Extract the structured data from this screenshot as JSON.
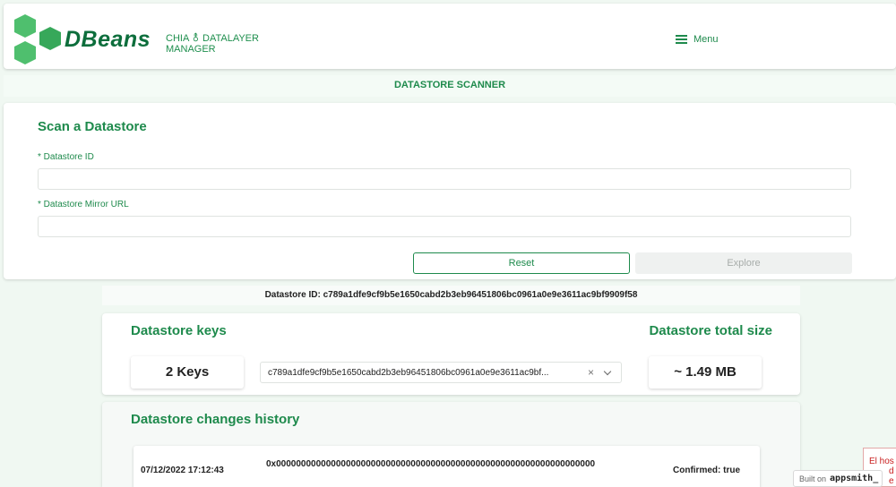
{
  "header": {
    "logo_word": "DBeans",
    "subtitle_line1": "CHIA ⚨ DATALAYER",
    "subtitle_line2": "MANAGER",
    "menu_label": "Menu",
    "menu_icon": "hamburger-icon",
    "logo_icon": "hexagon-cluster-logo"
  },
  "page_title": "DATASTORE SCANNER",
  "scan_form": {
    "title": "Scan a Datastore",
    "datastore_id_label": "* Datastore ID",
    "datastore_id_value": "",
    "mirror_url_label": "* Datastore Mirror URL",
    "mirror_url_value": "",
    "reset_label": "Reset",
    "explore_label": "Explore"
  },
  "datastore_id_line": "Datastore ID: c789a1dfe9cf9b5e1650cabd2b3eb96451806bc0961a0e9e3611ac9bf9909f58",
  "keys_section": {
    "title": "Datastore keys",
    "count_text": "2 Keys",
    "selected_key": "c789a1dfe9cf9b5e1650cabd2b3eb96451806bc0961a0e9e3611ac9bf...",
    "clear_glyph": "×",
    "size_title": "Datastore total size",
    "size_text": "~ 1.49 MB"
  },
  "history": {
    "title": "Datastore changes history",
    "rows": [
      {
        "date": "07/12/2022 17:12:43",
        "hash": "0x0000000000000000000000000000000000000000000000000000000000000000",
        "status": "Confirmed: true"
      }
    ]
  },
  "overlay": {
    "host_text_line1": "El hos",
    "host_text_line2": "d",
    "host_text_line3": "e",
    "built_on": "Built on",
    "built_brand": "appsmith_"
  },
  "colors": {
    "accent": "#1e8a4c",
    "logo_dark": "#0d6e3c",
    "logo_light": "#4fbf6e",
    "page_bg": "#f0f8f2"
  }
}
